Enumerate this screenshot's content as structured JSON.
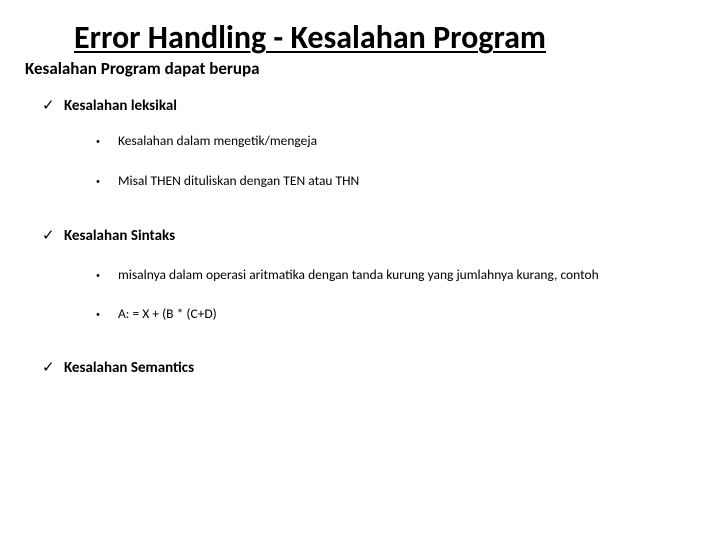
{
  "title": "Error Handling - Kesalahan Program",
  "subtitle": "Kesalahan Program dapat berupa",
  "items": [
    {
      "label": "Kesalahan leksikal",
      "subs": [
        "Kesalahan dalam mengetik/mengeja",
        "Misal THEN dituliskan dengan TEN atau THN"
      ]
    },
    {
      "label": "Kesalahan Sintaks",
      "subs": [
        "misalnya dalam  operasi aritmatika dengan tanda kurung yang jumlahnya kurang, contoh",
        "A: = X + (B * (C+D)"
      ]
    },
    {
      "label": "Kesalahan Semantics",
      "subs": []
    }
  ]
}
